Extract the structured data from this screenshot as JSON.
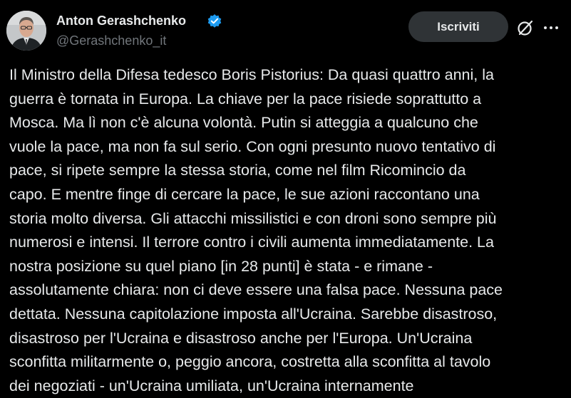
{
  "header": {
    "author_name": "Anton Gerashchenko",
    "handle": "@Gerashchenko_it",
    "subscribe_label": "Iscriviti",
    "verified_icon": "verified-badge-icon",
    "grok_icon": "grok-icon",
    "more_icon": "more-icon"
  },
  "colors": {
    "background": "#000000",
    "text": "#e7e9ea",
    "secondary_text": "#71767b",
    "button_bg": "#2f3336",
    "verified_blue": "#1d9bf0"
  },
  "tweet": {
    "lines": [
      "Il Ministro della Difesa tedesco Boris Pistorius: Da quasi quattro anni, la",
      "guerra è tornata in Europa. La chiave per la pace risiede soprattutto a",
      "Mosca. Ma lì non c'è alcuna volontà. Putin si atteggia a qualcuno che",
      "vuole la pace, ma non fa sul serio. Con ogni presunto nuovo tentativo di",
      "pace, si ripete sempre la stessa storia, come nel film Ricomincio da",
      "capo. E mentre finge di cercare la pace, le sue azioni raccontano una",
      "storia molto diversa. Gli attacchi missilistici e con droni sono sempre più",
      "numerosi e intensi. Il terrore contro i civili aumenta immediatamente. La",
      "nostra posizione su quel piano [in 28 punti] è stata - e rimane -",
      "assolutamente chiara: non ci deve essere una falsa pace. Nessuna pace",
      "dettata. Nessuna capitolazione imposta all'Ucraina. Sarebbe disastroso,",
      "disastroso per l'Ucraina e disastroso anche per l'Europa. Un'Ucraina",
      "sconfitta militarmente o, peggio ancora, costretta alla sconfitta al tavolo",
      "dei negoziati - un'Ucraina umiliata, un'Ucraina internamente"
    ]
  }
}
